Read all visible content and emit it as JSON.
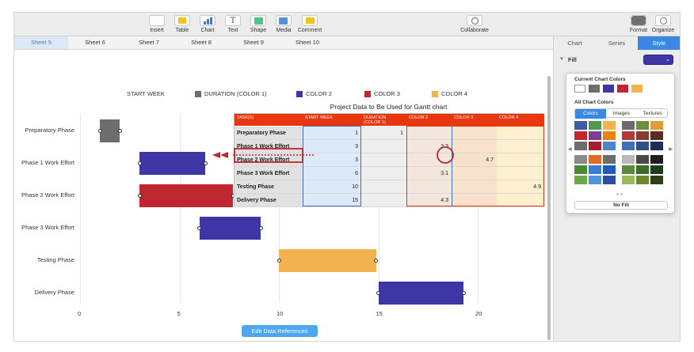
{
  "toolbar": {
    "insert": "Insert",
    "table": "Table",
    "chart": "Chart",
    "text": "Text",
    "text_glyph": "T",
    "shape": "Shape",
    "media": "Media",
    "comment": "Comment",
    "collaborate": "Collaborate",
    "format": "Format",
    "organize": "Organize"
  },
  "sheets": [
    "Sheet 5",
    "Sheet 6",
    "Sheet 7",
    "Sheet 8",
    "Sheet 9",
    "Sheet 10"
  ],
  "legend": [
    {
      "label": "START WEEK",
      "color": ""
    },
    {
      "label": "DURATION (COLOR 1)",
      "color": "#6d6d6d"
    },
    {
      "label": "COLOR 2",
      "color": "#3f36a6"
    },
    {
      "label": "COLOR 3",
      "color": "#c0262f"
    },
    {
      "label": "COLOR 4",
      "color": "#f2b34f"
    }
  ],
  "chart_data": {
    "type": "bar",
    "orientation": "horizontal",
    "stacked": true,
    "categories": [
      "Preparatory Phase",
      "Phase 1 Work Effort",
      "Phase 2 Work Effort",
      "Phase 3 Work Effort",
      "Testing Phase",
      "Delivery Phase"
    ],
    "series": [
      {
        "name": "START WEEK",
        "values": [
          1,
          3,
          3,
          6,
          10,
          15
        ]
      },
      {
        "name": "DURATION (COLOR 1)",
        "values": [
          1,
          0,
          0,
          0,
          0,
          0
        ]
      },
      {
        "name": "COLOR 2",
        "values": [
          0,
          3.3,
          0,
          3.1,
          0,
          4.3
        ]
      },
      {
        "name": "COLOR 3",
        "values": [
          0,
          0,
          4.7,
          0,
          0,
          0
        ]
      },
      {
        "name": "COLOR 4",
        "values": [
          0,
          0,
          0,
          0,
          4.9,
          0
        ]
      }
    ],
    "x_ticks": [
      "0",
      "5",
      "10",
      "15",
      "20"
    ],
    "xlim": [
      0,
      23
    ],
    "grid": "vertical"
  },
  "table": {
    "title": "Project Data to Be Used for Gantt chart",
    "headers": [
      "TASK(S)",
      "START WEEK",
      "DURATION (COLOR 1)",
      "COLOR 2",
      "COLOR 3",
      "COLOR 4"
    ],
    "rows": [
      [
        "Preparatory Phase",
        "1",
        "1",
        "",
        "",
        ""
      ],
      [
        "Phase 1 Work Effort",
        "3",
        "",
        "3.3",
        "",
        ""
      ],
      [
        "Phase 2 Work Effort",
        "3",
        "",
        "",
        "4.7",
        ""
      ],
      [
        "Phase 3 Work Effort",
        "6",
        "",
        "3.1",
        "",
        ""
      ],
      [
        "Testing Phase",
        "10",
        "",
        "",
        "",
        "4.9"
      ],
      [
        "Delivery Phase",
        "15",
        "",
        "4.3",
        "",
        ""
      ]
    ]
  },
  "edit_button": "Edit Data References",
  "inspector": {
    "tabs": [
      "Chart",
      "Series",
      "Style"
    ],
    "active_tab": "Style",
    "fill_label": "Fill",
    "fill_color": "#3f36a6"
  },
  "popover": {
    "current_title": "Current Chart Colors",
    "current_colors": [
      "#6d6d6d",
      "#3f36a6",
      "#c0262f",
      "#f2b34f"
    ],
    "all_title": "All Chart Colors",
    "tabs": [
      "Colors",
      "Images",
      "Textures"
    ],
    "no_fill": "No Fill"
  }
}
